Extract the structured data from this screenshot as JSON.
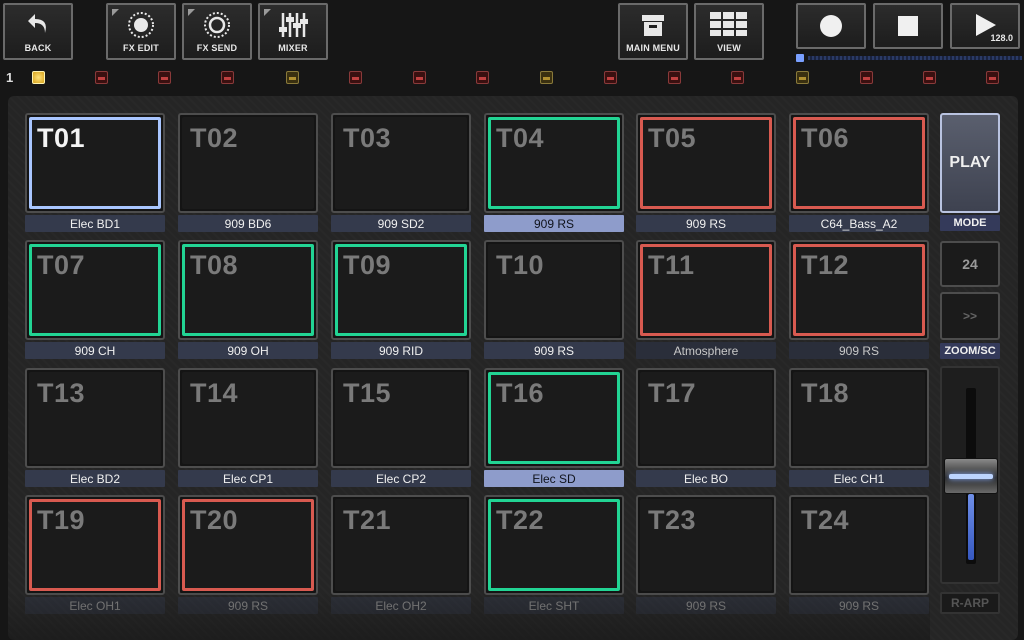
{
  "toolbar": {
    "back": "BACK",
    "fx_edit": "FX EDIT",
    "fx_send": "FX SEND",
    "mixer": "MIXER",
    "main_menu": "MAIN MENU",
    "view": "VIEW",
    "tempo": "128.0"
  },
  "transport": {
    "progress": 0.0
  },
  "bank": {
    "number": "1",
    "leds": [
      "active",
      "red",
      "red",
      "amber",
      "red",
      "red",
      "red",
      "amber",
      "red",
      "red",
      "red",
      "amber",
      "red",
      "red",
      "red",
      "red"
    ]
  },
  "pads": [
    {
      "id": "T01",
      "sample": "Elec BD1",
      "state": "selected",
      "label_style": "normal"
    },
    {
      "id": "T02",
      "sample": "909 BD6",
      "state": "off",
      "label_style": "normal"
    },
    {
      "id": "T03",
      "sample": "909 SD2",
      "state": "off",
      "label_style": "normal"
    },
    {
      "id": "T04",
      "sample": "909 RS",
      "state": "green",
      "label_style": "hi"
    },
    {
      "id": "T05",
      "sample": "909 RS",
      "state": "red",
      "label_style": "normal"
    },
    {
      "id": "T06",
      "sample": "C64_Bass_A2",
      "state": "red",
      "label_style": "normal"
    },
    {
      "id": "T07",
      "sample": "909 CH",
      "state": "green",
      "label_style": "normal"
    },
    {
      "id": "T08",
      "sample": "909 OH",
      "state": "green",
      "label_style": "normal"
    },
    {
      "id": "T09",
      "sample": "909 RID",
      "state": "green",
      "label_style": "normal"
    },
    {
      "id": "T10",
      "sample": "909 RS",
      "state": "off",
      "label_style": "normal"
    },
    {
      "id": "T11",
      "sample": "Atmosphere",
      "state": "red",
      "label_style": "dim"
    },
    {
      "id": "T12",
      "sample": "909 RS",
      "state": "red",
      "label_style": "dim"
    },
    {
      "id": "T13",
      "sample": "Elec BD2",
      "state": "off",
      "label_style": "normal"
    },
    {
      "id": "T14",
      "sample": "Elec CP1",
      "state": "off",
      "label_style": "normal"
    },
    {
      "id": "T15",
      "sample": "Elec CP2",
      "state": "off",
      "label_style": "normal"
    },
    {
      "id": "T16",
      "sample": "Elec SD",
      "state": "green",
      "label_style": "hi"
    },
    {
      "id": "T17",
      "sample": "Elec BO",
      "state": "off",
      "label_style": "normal"
    },
    {
      "id": "T18",
      "sample": "Elec CH1",
      "state": "off",
      "label_style": "normal"
    },
    {
      "id": "T19",
      "sample": "Elec OH1",
      "state": "red",
      "label_style": "fade"
    },
    {
      "id": "T20",
      "sample": "909 RS",
      "state": "red",
      "label_style": "fade"
    },
    {
      "id": "T21",
      "sample": "Elec OH2",
      "state": "off",
      "label_style": "fade"
    },
    {
      "id": "T22",
      "sample": "Elec SHT",
      "state": "green",
      "label_style": "fade"
    },
    {
      "id": "T23",
      "sample": "909 RS",
      "state": "off",
      "label_style": "fade"
    },
    {
      "id": "T24",
      "sample": "909 RS",
      "state": "off",
      "label_style": "fade"
    }
  ],
  "right_panel": {
    "mode_button": "PLAY",
    "mode_label": "MODE",
    "zoom_value": "24",
    "zoom_next": ">>",
    "zoom_label": "ZOOM/SC",
    "fader_level": 0.5,
    "arp_label": "R-ARP"
  },
  "colors": {
    "selected": "#a9c6ff",
    "green": "#22d494",
    "red": "#d85a50",
    "label": "#343a4c",
    "label_highlight": "#8e9ccb"
  }
}
